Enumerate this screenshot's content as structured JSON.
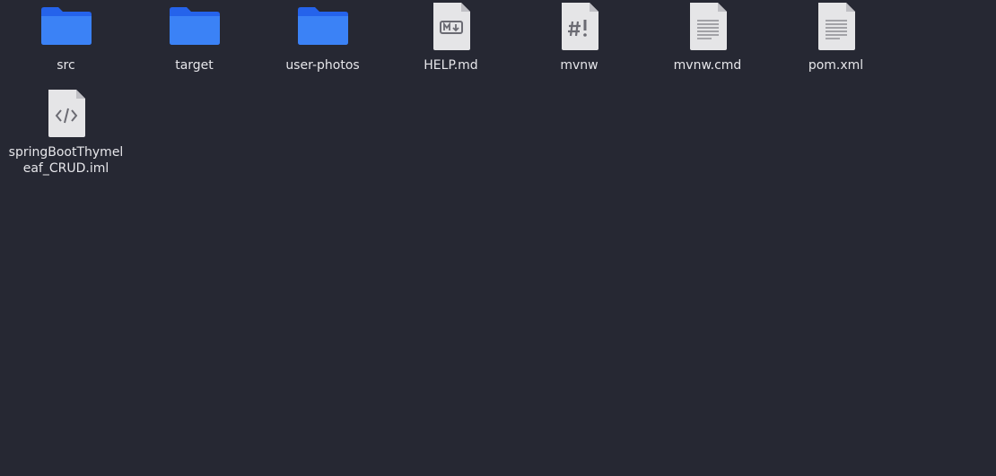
{
  "colors": {
    "background": "#262833",
    "folder_blue": "#3b82f6",
    "folder_blue_dark": "#2563eb",
    "file_paper": "#e5e5e7",
    "file_glyph": "#6b6b73",
    "label_text": "#e6e6ea"
  },
  "files": [
    {
      "name": "src",
      "kind": "folder",
      "icon": "folder-icon"
    },
    {
      "name": "target",
      "kind": "folder",
      "icon": "folder-icon"
    },
    {
      "name": "user-photos",
      "kind": "folder",
      "icon": "folder-icon"
    },
    {
      "name": "HELP.md",
      "kind": "markdown",
      "icon": "markdown-file-icon"
    },
    {
      "name": "mvnw",
      "kind": "script",
      "icon": "script-file-icon"
    },
    {
      "name": "mvnw.cmd",
      "kind": "text",
      "icon": "text-file-icon"
    },
    {
      "name": "pom.xml",
      "kind": "text",
      "icon": "text-file-icon"
    },
    {
      "name": "springBootThymeleaf_CRUD.iml",
      "kind": "code",
      "icon": "code-file-icon"
    }
  ]
}
